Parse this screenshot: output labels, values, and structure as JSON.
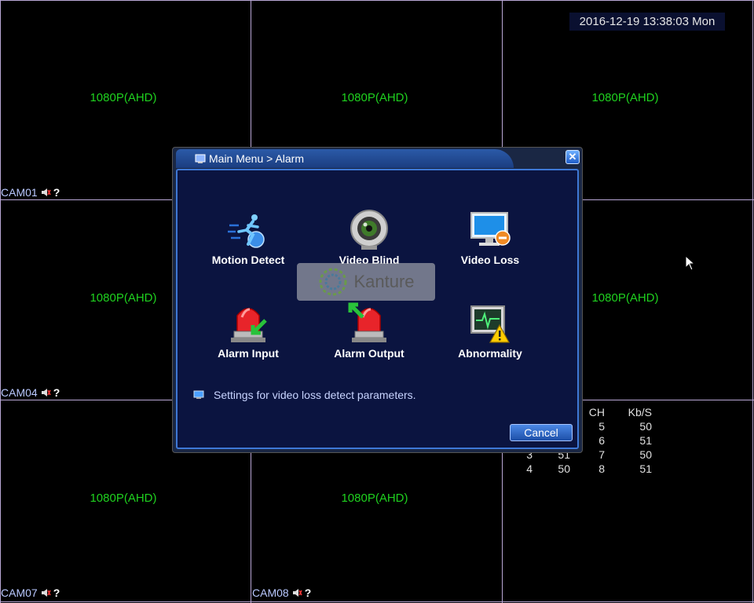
{
  "datetime": "2016-12-19 13:38:03 Mon",
  "cells": [
    {
      "resolution": "1080P(AHD)",
      "cam_label": "CAM01"
    },
    {
      "resolution": "1080P(AHD)",
      "cam_label": ""
    },
    {
      "resolution": "1080P(AHD)",
      "cam_label": ""
    },
    {
      "resolution": "1080P(AHD)",
      "cam_label": "CAM04"
    },
    {
      "resolution": "",
      "cam_label": ""
    },
    {
      "resolution": "1080P(AHD)",
      "cam_label": ""
    },
    {
      "resolution": "1080P(AHD)",
      "cam_label": "CAM07"
    },
    {
      "resolution": "1080P(AHD)",
      "cam_label": "CAM08"
    },
    {
      "resolution": "",
      "cam_label": ""
    }
  ],
  "dialog": {
    "title": "Main Menu > Alarm",
    "close_label": "✕",
    "items": [
      {
        "label": "Motion Detect",
        "icon": "motion-detect-icon"
      },
      {
        "label": "Video Blind",
        "icon": "video-blind-icon"
      },
      {
        "label": "Video Loss",
        "icon": "video-loss-icon"
      },
      {
        "label": "Alarm Input",
        "icon": "alarm-input-icon"
      },
      {
        "label": "Alarm Output",
        "icon": "alarm-output-icon"
      },
      {
        "label": "Abnormality",
        "icon": "abnormality-icon"
      }
    ],
    "hint": "Settings for video loss detect parameters.",
    "cancel_label": "Cancel",
    "watermark": "Kanture"
  },
  "stats": {
    "headers": [
      "",
      "",
      "CH",
      "Kb/S"
    ],
    "rows": [
      [
        "",
        "",
        "5",
        "50"
      ],
      [
        "",
        "",
        "6",
        "51"
      ],
      [
        "3",
        "51",
        "7",
        "50"
      ],
      [
        "4",
        "50",
        "8",
        "51"
      ]
    ]
  },
  "colors": {
    "resolution_text": "#1fd21f",
    "grid_line": "#b9a7d6",
    "cam_label": "#b9c8ff"
  }
}
